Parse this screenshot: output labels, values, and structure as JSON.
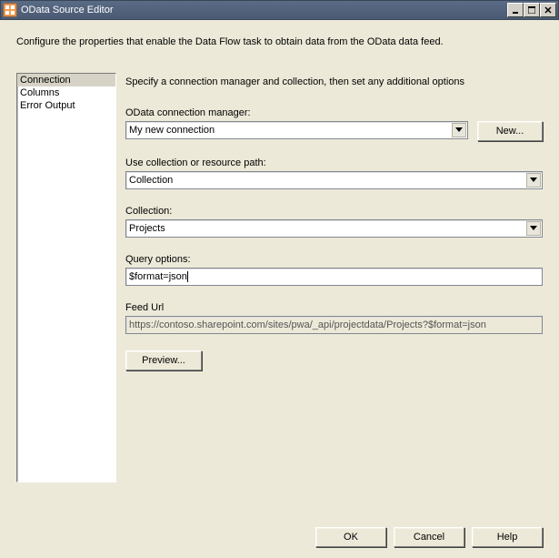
{
  "window": {
    "title": "OData Source Editor"
  },
  "description": "Configure the properties that enable the Data Flow task to obtain data from the OData data feed.",
  "nav": {
    "items": [
      {
        "label": "Connection",
        "selected": true
      },
      {
        "label": "Columns",
        "selected": false
      },
      {
        "label": "Error Output",
        "selected": false
      }
    ]
  },
  "form": {
    "instruction": "Specify a connection manager and collection, then set any additional options",
    "conn_label": "OData connection manager:",
    "conn_value": "My new connection",
    "new_btn": "New...",
    "path_label": "Use collection or resource path:",
    "path_value": "Collection",
    "collection_label": "Collection:",
    "collection_value": "Projects",
    "query_label": "Query options:",
    "query_value": "$format=json",
    "feed_label": "Feed Url",
    "feed_value": "https://contoso.sharepoint.com/sites/pwa/_api/projectdata/Projects?$format=json",
    "preview_btn": "Preview..."
  },
  "footer": {
    "ok": "OK",
    "cancel": "Cancel",
    "help": "Help"
  }
}
